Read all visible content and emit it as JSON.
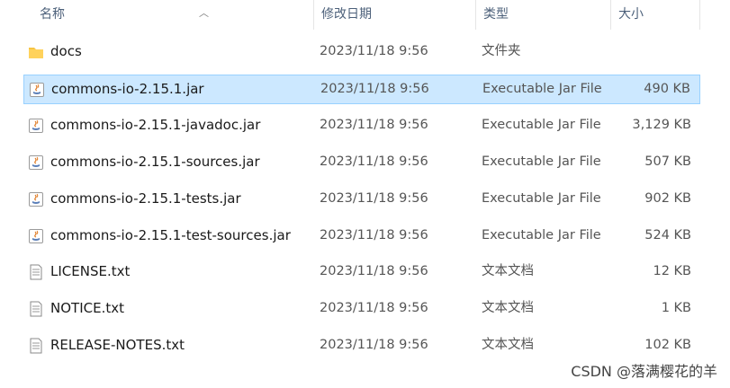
{
  "columns": {
    "name": "名称",
    "date": "修改日期",
    "type": "类型",
    "size": "大小"
  },
  "files": [
    {
      "name": "docs",
      "date": "2023/11/18 9:56",
      "type": "文件夹",
      "size": "",
      "icon": "folder-icon",
      "selected": false
    },
    {
      "name": "commons-io-2.15.1.jar",
      "date": "2023/11/18 9:56",
      "type": "Executable Jar File",
      "size": "490 KB",
      "icon": "jar-icon",
      "selected": true
    },
    {
      "name": "commons-io-2.15.1-javadoc.jar",
      "date": "2023/11/18 9:56",
      "type": "Executable Jar File",
      "size": "3,129 KB",
      "icon": "jar-icon",
      "selected": false
    },
    {
      "name": "commons-io-2.15.1-sources.jar",
      "date": "2023/11/18 9:56",
      "type": "Executable Jar File",
      "size": "507 KB",
      "icon": "jar-icon",
      "selected": false
    },
    {
      "name": "commons-io-2.15.1-tests.jar",
      "date": "2023/11/18 9:56",
      "type": "Executable Jar File",
      "size": "902 KB",
      "icon": "jar-icon",
      "selected": false
    },
    {
      "name": "commons-io-2.15.1-test-sources.jar",
      "date": "2023/11/18 9:56",
      "type": "Executable Jar File",
      "size": "524 KB",
      "icon": "jar-icon",
      "selected": false
    },
    {
      "name": "LICENSE.txt",
      "date": "2023/11/18 9:56",
      "type": "文本文档",
      "size": "12 KB",
      "icon": "text-file-icon",
      "selected": false
    },
    {
      "name": "NOTICE.txt",
      "date": "2023/11/18 9:56",
      "type": "文本文档",
      "size": "1 KB",
      "icon": "text-file-icon",
      "selected": false
    },
    {
      "name": "RELEASE-NOTES.txt",
      "date": "2023/11/18 9:56",
      "type": "文本文档",
      "size": "102 KB",
      "icon": "text-file-icon",
      "selected": false
    }
  ],
  "watermark": "CSDN @落满樱花的羊",
  "colors": {
    "selection_bg": "#cce8ff",
    "selection_border": "#99d1ff",
    "folder": "#f6c443",
    "header_text": "#4c607a"
  }
}
